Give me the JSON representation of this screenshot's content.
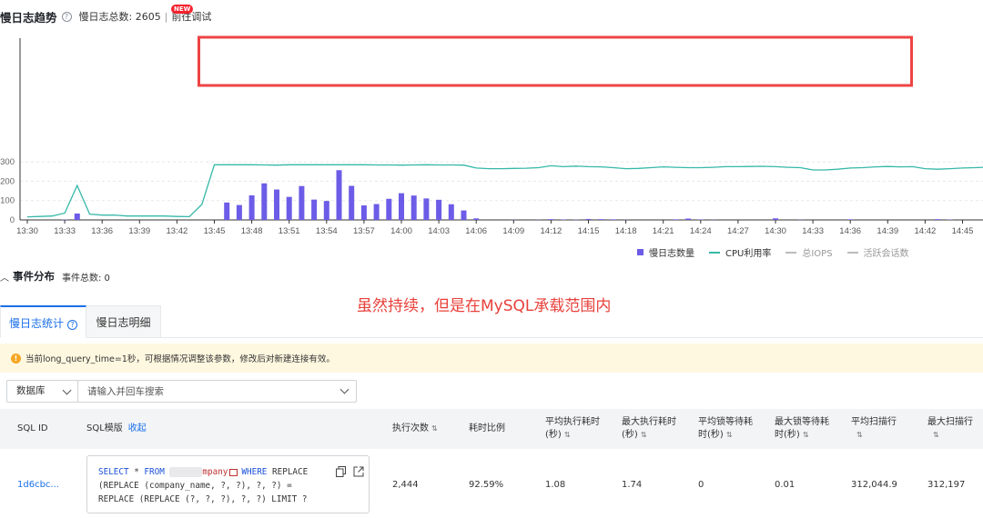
{
  "header": {
    "title": "慢日志趋势",
    "count_text": "慢日志总数: 2605",
    "separator": "|",
    "link_label": "前往调试",
    "new_badge": "NEW"
  },
  "chart_data": {
    "type": "bar+line",
    "ylim": [
      0,
      300
    ],
    "y_ticks": [
      "0",
      "100",
      "200",
      "300"
    ],
    "x_tick_labels": [
      "13:30",
      "13:33",
      "13:36",
      "13:39",
      "13:42",
      "13:45",
      "13:48",
      "13:51",
      "13:54",
      "13:57",
      "14:00",
      "14:03",
      "14:06",
      "14:09",
      "14:12",
      "14:15",
      "14:18",
      "14:21",
      "14:24",
      "14:27",
      "14:30",
      "14:33",
      "14:36",
      "14:39",
      "14:42",
      "14:45"
    ],
    "x_start_minute": 0,
    "x_step_minutes": 1,
    "bars_series": {
      "name": "慢日志数量",
      "color": "#6c5ce7",
      "values": [
        0,
        0,
        0,
        2,
        33,
        0,
        0,
        0,
        0,
        0,
        0,
        0,
        0,
        0,
        0,
        0,
        90,
        77,
        127,
        189,
        157,
        119,
        175,
        105,
        98,
        257,
        176,
        75,
        82,
        109,
        138,
        126,
        111,
        104,
        81,
        49,
        8,
        0,
        0,
        1,
        0,
        1,
        4,
        2,
        2,
        5,
        4,
        3,
        1,
        0,
        0,
        0,
        3,
        7,
        2,
        1,
        0,
        0,
        0,
        0,
        8,
        0,
        1,
        0,
        0,
        0,
        3,
        0,
        0,
        0,
        0,
        0,
        0,
        4,
        2,
        0,
        0,
        0,
        0,
        0,
        2,
        2,
        2,
        0,
        0,
        0,
        2
      ]
    },
    "line_series": {
      "name": "CPU利用率",
      "color": "#36b8a8",
      "values": [
        16,
        18,
        20,
        35,
        178,
        30,
        25,
        25,
        20,
        20,
        20,
        20,
        18,
        17,
        80,
        285,
        285,
        285,
        285,
        284,
        283,
        285,
        285,
        285,
        285,
        285,
        285,
        285,
        284,
        284,
        283,
        284,
        285,
        284,
        284,
        283,
        268,
        265,
        265,
        266,
        267,
        270,
        280,
        275,
        278,
        275,
        274,
        270,
        265,
        266,
        270,
        274,
        272,
        270,
        270,
        272,
        275,
        275,
        276,
        277,
        275,
        272,
        270,
        258,
        258,
        262,
        268,
        270,
        274,
        276,
        274,
        275,
        265,
        262,
        265,
        268,
        270,
        273,
        274,
        272,
        270,
        268
      ],
      "value_label": "CPU利用率"
    },
    "legend": [
      {
        "name": "慢日志数量",
        "kind": "bar",
        "color": "#6c5ce7",
        "active": true
      },
      {
        "name": "CPU利用率",
        "kind": "line",
        "color": "#36b8a8",
        "active": true
      },
      {
        "name": "总IOPS",
        "kind": "line",
        "color": "#bbbbbb",
        "active": false
      },
      {
        "name": "活跃会话数",
        "kind": "line",
        "color": "#bbbbbb",
        "active": false
      }
    ],
    "legend_position": "bottom-right",
    "highlight_box_color": "#ee4444",
    "grid": true
  },
  "events": {
    "title": "事件分布",
    "count_text": "事件总数: 0"
  },
  "annotation": "虽然持续，但是在MySQL承载范围内",
  "tabs": [
    {
      "label": "慢日志统计",
      "active": true
    },
    {
      "label": "慢日志明细",
      "active": false
    }
  ],
  "notice": "当前long_query_time=1秒，可根据情况调整该参数，修改后对新建连接有效。",
  "filter": {
    "db_select": "数据库",
    "search_placeholder": "请输入并回车搜索"
  },
  "table": {
    "columns": {
      "sql_id": "SQL ID",
      "template": "SQL模版",
      "collapse": "收起",
      "exec_count": "执行次数",
      "time_ratio": "耗时比例",
      "avg_exec_1": "平均执行耗时",
      "avg_exec_2": "(秒)",
      "max_exec_1": "最大执行耗时",
      "max_exec_2": "(秒)",
      "avg_lock_1": "平均锁等待耗",
      "avg_lock_2": "时(秒)",
      "max_lock_1": "最大锁等待耗",
      "max_lock_2": "时(秒)",
      "avg_scan_1": "平均扫描行",
      "max_scan_1": "最大扫描行"
    },
    "rows": [
      {
        "sql_id": "1d6cbc...",
        "sql": {
          "kw_select": "SELECT",
          "star": "*",
          "kw_from": "FROM",
          "table_tail": "mpany",
          "kw_where": "WHERE",
          "line1_rest": "REPLACE",
          "line2": "(REPLACE (company_name, ?, ?), ?, ?) =",
          "line3": "REPLACE (REPLACE (?, ?, ?), ?, ?) LIMIT ?"
        },
        "exec_count": "2,444",
        "time_ratio": "92.59%",
        "avg_exec": "1.08",
        "max_exec": "1.74",
        "avg_lock": "0",
        "max_lock": "0.01",
        "avg_scan": "312,044.9",
        "max_scan": "312,197"
      }
    ]
  },
  "colors": {
    "accent": "#1a6fe8",
    "warning_bg": "#fff8e0",
    "annotation": "#e8403a"
  }
}
